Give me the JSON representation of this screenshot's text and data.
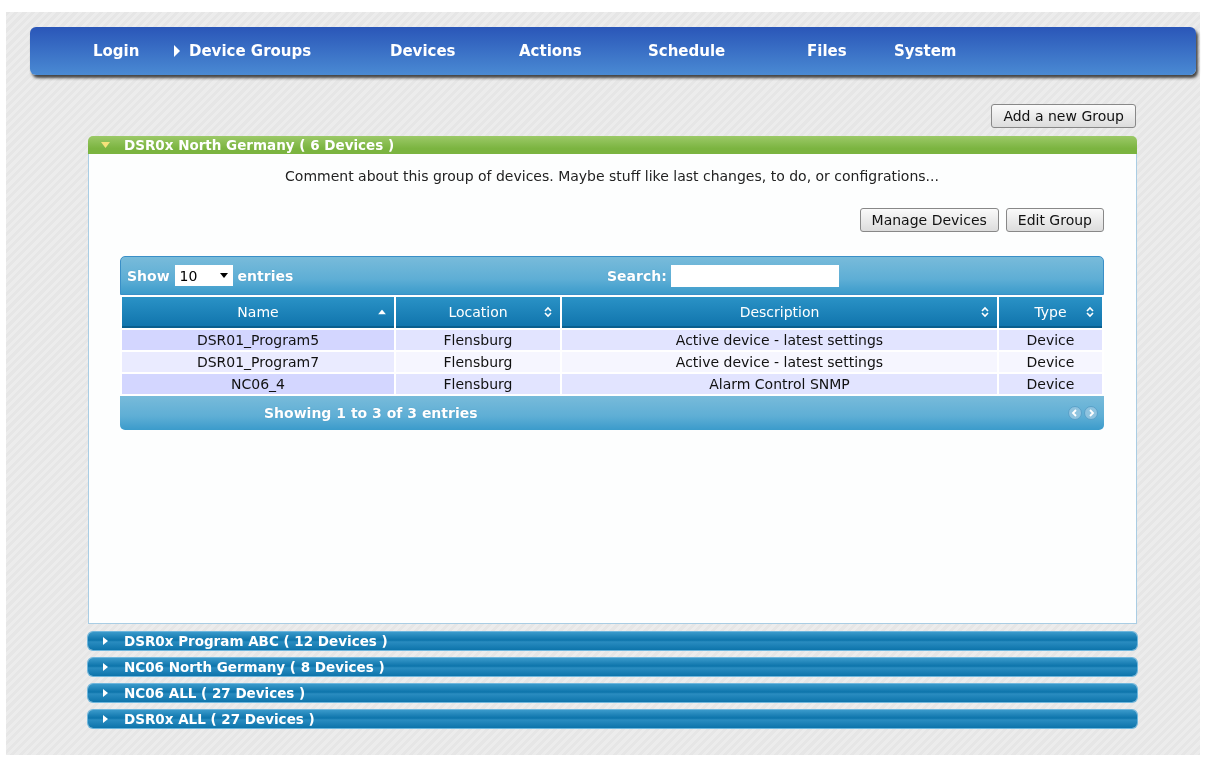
{
  "nav": [
    {
      "label": "Login",
      "selected": false
    },
    {
      "label": "Device Groups",
      "selected": true
    },
    {
      "label": "Devices",
      "selected": false
    },
    {
      "label": "Actions",
      "selected": false
    },
    {
      "label": "Schedule",
      "selected": false
    },
    {
      "label": "Files",
      "selected": false
    },
    {
      "label": "System",
      "selected": false
    }
  ],
  "add_button": "Add a new Group",
  "groups": [
    {
      "title": "DSR0x North Germany ( 6 Devices )",
      "expanded": true,
      "comment": "Comment about this group of devices. Maybe stuff like last changes, to do, or configrations...",
      "buttons": [
        "Manage Devices",
        "Edit Group"
      ],
      "table": {
        "show_label": "Show",
        "page_size": "10",
        "entries_label": "entries",
        "search_label": "Search:",
        "columns": [
          {
            "label": "Name",
            "sorted": true
          },
          {
            "label": "Location",
            "sorted": false
          },
          {
            "label": "Description",
            "sorted": false
          },
          {
            "label": "Type",
            "sorted": false
          }
        ],
        "rows": [
          [
            "DSR01_Program5",
            "Flensburg",
            "Active device - latest settings",
            "Device"
          ],
          [
            "DSR01_Program7",
            "Flensburg",
            "Active device - latest settings",
            "Device"
          ],
          [
            "NC06_4",
            "Flensburg",
            "Alarm Control SNMP",
            "Device"
          ]
        ],
        "info": "Showing 1 to 3 of 3 entries"
      }
    },
    {
      "title": "DSR0x Program ABC ( 12 Devices )",
      "expanded": false
    },
    {
      "title": "NC06 North Germany ( 8 Devices )",
      "expanded": false
    },
    {
      "title": "NC06 ALL ( 27 Devices )",
      "expanded": false
    },
    {
      "title": "DSR0x ALL ( 27 Devices )",
      "expanded": false
    }
  ]
}
